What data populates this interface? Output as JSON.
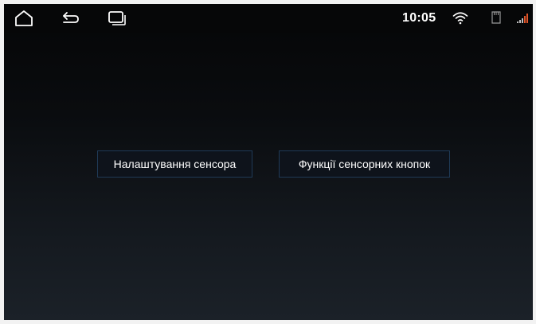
{
  "status_bar": {
    "time": "10:05",
    "icons": [
      "home-icon",
      "back-icon",
      "recent-apps-icon",
      "wifi-icon",
      "sd-card-icon",
      "signal-icon"
    ]
  },
  "main": {
    "buttons": [
      {
        "label": "Налаштування сенсора"
      },
      {
        "label": "Функції сенсорних кнопок"
      }
    ]
  },
  "colors": {
    "background_top": "#050607",
    "background_bottom": "#1b2128",
    "button_border": "#1f3a57",
    "text": "#ffffff",
    "signal_accent": "#e0552a"
  }
}
